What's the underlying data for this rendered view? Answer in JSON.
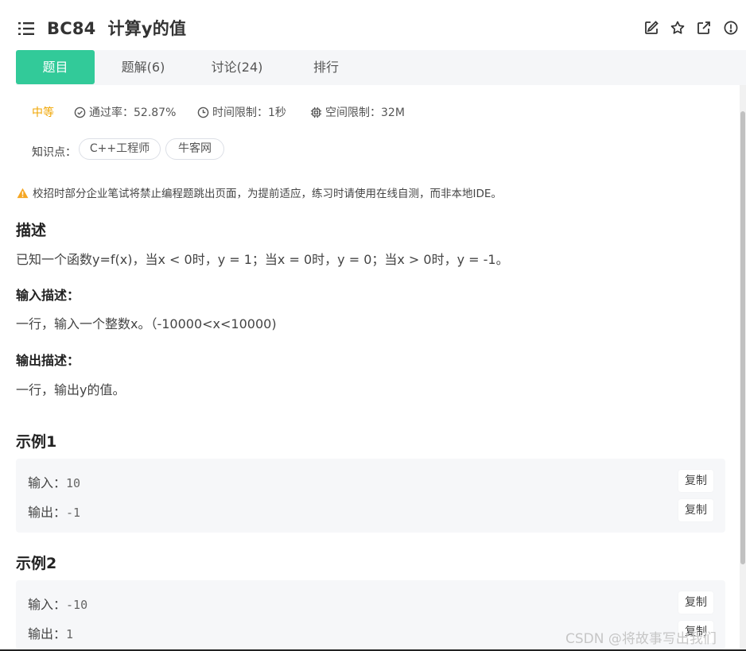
{
  "header": {
    "title": "BC84  计算y的值",
    "icons": [
      "edit-icon",
      "star-icon",
      "external-link-icon",
      "report-icon"
    ]
  },
  "tabs": [
    {
      "label": "题目",
      "active": true
    },
    {
      "label": "题解(6)",
      "active": false
    },
    {
      "label": "讨论(24)",
      "active": false
    },
    {
      "label": "排行",
      "active": false
    }
  ],
  "meta": {
    "difficulty": "中等",
    "pass_rate": "通过率：52.87%",
    "time_limit": "时间限制：1秒",
    "space_limit": "空间限制：32M"
  },
  "knowledge": {
    "label": "知识点：",
    "tags": [
      "C++工程师",
      "牛客网"
    ]
  },
  "notice": "校招时部分企业笔试将禁止编程题跳出页面，为提前适应，练习时请使用在线自测，而非本地IDE。",
  "description": {
    "heading": "描述",
    "text": "已知一个函数y=f(x)，当x < 0时，y = 1；当x = 0时，y = 0；当x > 0时，y = -1。"
  },
  "input_desc": {
    "heading": "输入描述：",
    "text": "一行，输入一个整数x。（-10000<x<10000)"
  },
  "output_desc": {
    "heading": "输出描述：",
    "text": "一行，输出y的值。"
  },
  "examples": [
    {
      "heading": "示例1",
      "input_label": "输入：",
      "input": "10",
      "output_label": "输出：",
      "output": "-1",
      "copy_label": "复制"
    },
    {
      "heading": "示例2",
      "input_label": "输入：",
      "input": "-10",
      "output_label": "输出：",
      "output": "1",
      "copy_label": "复制"
    }
  ],
  "watermark": "CSDN @将故事写出我们",
  "colors": {
    "accent": "#32ca99",
    "difficulty": "#f0a500",
    "warning": "#f5a623"
  }
}
